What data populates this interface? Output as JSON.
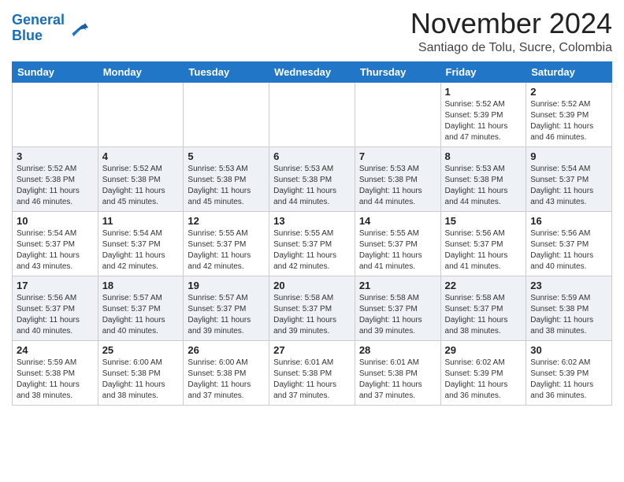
{
  "header": {
    "logo": {
      "line1": "General",
      "line2": "Blue"
    },
    "month": "November 2024",
    "location": "Santiago de Tolu, Sucre, Colombia"
  },
  "weekdays": [
    "Sunday",
    "Monday",
    "Tuesday",
    "Wednesday",
    "Thursday",
    "Friday",
    "Saturday"
  ],
  "weeks": [
    [
      {
        "day": "",
        "info": ""
      },
      {
        "day": "",
        "info": ""
      },
      {
        "day": "",
        "info": ""
      },
      {
        "day": "",
        "info": ""
      },
      {
        "day": "",
        "info": ""
      },
      {
        "day": "1",
        "info": "Sunrise: 5:52 AM\nSunset: 5:39 PM\nDaylight: 11 hours\nand 47 minutes."
      },
      {
        "day": "2",
        "info": "Sunrise: 5:52 AM\nSunset: 5:39 PM\nDaylight: 11 hours\nand 46 minutes."
      }
    ],
    [
      {
        "day": "3",
        "info": "Sunrise: 5:52 AM\nSunset: 5:38 PM\nDaylight: 11 hours\nand 46 minutes."
      },
      {
        "day": "4",
        "info": "Sunrise: 5:52 AM\nSunset: 5:38 PM\nDaylight: 11 hours\nand 45 minutes."
      },
      {
        "day": "5",
        "info": "Sunrise: 5:53 AM\nSunset: 5:38 PM\nDaylight: 11 hours\nand 45 minutes."
      },
      {
        "day": "6",
        "info": "Sunrise: 5:53 AM\nSunset: 5:38 PM\nDaylight: 11 hours\nand 44 minutes."
      },
      {
        "day": "7",
        "info": "Sunrise: 5:53 AM\nSunset: 5:38 PM\nDaylight: 11 hours\nand 44 minutes."
      },
      {
        "day": "8",
        "info": "Sunrise: 5:53 AM\nSunset: 5:38 PM\nDaylight: 11 hours\nand 44 minutes."
      },
      {
        "day": "9",
        "info": "Sunrise: 5:54 AM\nSunset: 5:37 PM\nDaylight: 11 hours\nand 43 minutes."
      }
    ],
    [
      {
        "day": "10",
        "info": "Sunrise: 5:54 AM\nSunset: 5:37 PM\nDaylight: 11 hours\nand 43 minutes."
      },
      {
        "day": "11",
        "info": "Sunrise: 5:54 AM\nSunset: 5:37 PM\nDaylight: 11 hours\nand 42 minutes."
      },
      {
        "day": "12",
        "info": "Sunrise: 5:55 AM\nSunset: 5:37 PM\nDaylight: 11 hours\nand 42 minutes."
      },
      {
        "day": "13",
        "info": "Sunrise: 5:55 AM\nSunset: 5:37 PM\nDaylight: 11 hours\nand 42 minutes."
      },
      {
        "day": "14",
        "info": "Sunrise: 5:55 AM\nSunset: 5:37 PM\nDaylight: 11 hours\nand 41 minutes."
      },
      {
        "day": "15",
        "info": "Sunrise: 5:56 AM\nSunset: 5:37 PM\nDaylight: 11 hours\nand 41 minutes."
      },
      {
        "day": "16",
        "info": "Sunrise: 5:56 AM\nSunset: 5:37 PM\nDaylight: 11 hours\nand 40 minutes."
      }
    ],
    [
      {
        "day": "17",
        "info": "Sunrise: 5:56 AM\nSunset: 5:37 PM\nDaylight: 11 hours\nand 40 minutes."
      },
      {
        "day": "18",
        "info": "Sunrise: 5:57 AM\nSunset: 5:37 PM\nDaylight: 11 hours\nand 40 minutes."
      },
      {
        "day": "19",
        "info": "Sunrise: 5:57 AM\nSunset: 5:37 PM\nDaylight: 11 hours\nand 39 minutes."
      },
      {
        "day": "20",
        "info": "Sunrise: 5:58 AM\nSunset: 5:37 PM\nDaylight: 11 hours\nand 39 minutes."
      },
      {
        "day": "21",
        "info": "Sunrise: 5:58 AM\nSunset: 5:37 PM\nDaylight: 11 hours\nand 39 minutes."
      },
      {
        "day": "22",
        "info": "Sunrise: 5:58 AM\nSunset: 5:37 PM\nDaylight: 11 hours\nand 38 minutes."
      },
      {
        "day": "23",
        "info": "Sunrise: 5:59 AM\nSunset: 5:38 PM\nDaylight: 11 hours\nand 38 minutes."
      }
    ],
    [
      {
        "day": "24",
        "info": "Sunrise: 5:59 AM\nSunset: 5:38 PM\nDaylight: 11 hours\nand 38 minutes."
      },
      {
        "day": "25",
        "info": "Sunrise: 6:00 AM\nSunset: 5:38 PM\nDaylight: 11 hours\nand 38 minutes."
      },
      {
        "day": "26",
        "info": "Sunrise: 6:00 AM\nSunset: 5:38 PM\nDaylight: 11 hours\nand 37 minutes."
      },
      {
        "day": "27",
        "info": "Sunrise: 6:01 AM\nSunset: 5:38 PM\nDaylight: 11 hours\nand 37 minutes."
      },
      {
        "day": "28",
        "info": "Sunrise: 6:01 AM\nSunset: 5:38 PM\nDaylight: 11 hours\nand 37 minutes."
      },
      {
        "day": "29",
        "info": "Sunrise: 6:02 AM\nSunset: 5:39 PM\nDaylight: 11 hours\nand 36 minutes."
      },
      {
        "day": "30",
        "info": "Sunrise: 6:02 AM\nSunset: 5:39 PM\nDaylight: 11 hours\nand 36 minutes."
      }
    ]
  ]
}
